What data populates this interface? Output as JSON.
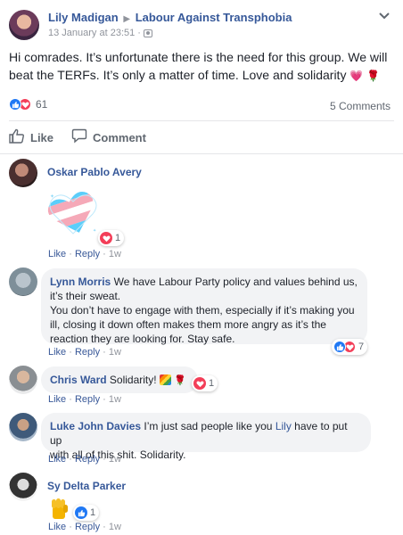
{
  "post": {
    "author": "Lily Madigan",
    "group": "Labour Against Transphobia",
    "timestamp": "13 January at 23:51",
    "text": "Hi comrades. It’s unfortunate there is the need for this group. We will beat the TERFs. It’s only a matter of time. Love and solidarity",
    "reaction_count": "61",
    "comment_count": "5 Comments",
    "like_label": "Like",
    "comment_label": "Comment"
  },
  "labels": {
    "like": "Like",
    "reply": "Reply",
    "dot": "·"
  },
  "comments": [
    {
      "author": "Oskar Pablo Avery",
      "text": "",
      "age": "1w",
      "reactions": "1"
    },
    {
      "author": "Lynn Morris",
      "text_lines": [
        "We have Labour Party policy and values behind us,",
        "it’s their sweat.",
        "You don’t have to engage with them, especially if it’s making you",
        "ill, closing it down often makes them more angry as it’s the",
        "reaction they are looking for. Stay safe."
      ],
      "age": "1w",
      "reactions": "7"
    },
    {
      "author": "Chris Ward",
      "text": "Solidarity!",
      "age": "1w",
      "reactions": "1"
    },
    {
      "author": "Luke John Davies",
      "text_pre": "I’m just sad people like you",
      "mention": "Lily",
      "text_post": "have to put up",
      "text_line2": "with all of this shit. Solidarity.",
      "age": "1w"
    },
    {
      "author": "Sy Delta Parker",
      "text": "",
      "age": "1w",
      "reactions": "1"
    }
  ],
  "colors": {
    "link": "#365899",
    "like_blue": "#2078f4",
    "love_red": "#f33e58",
    "bubble": "#f2f3f5"
  }
}
